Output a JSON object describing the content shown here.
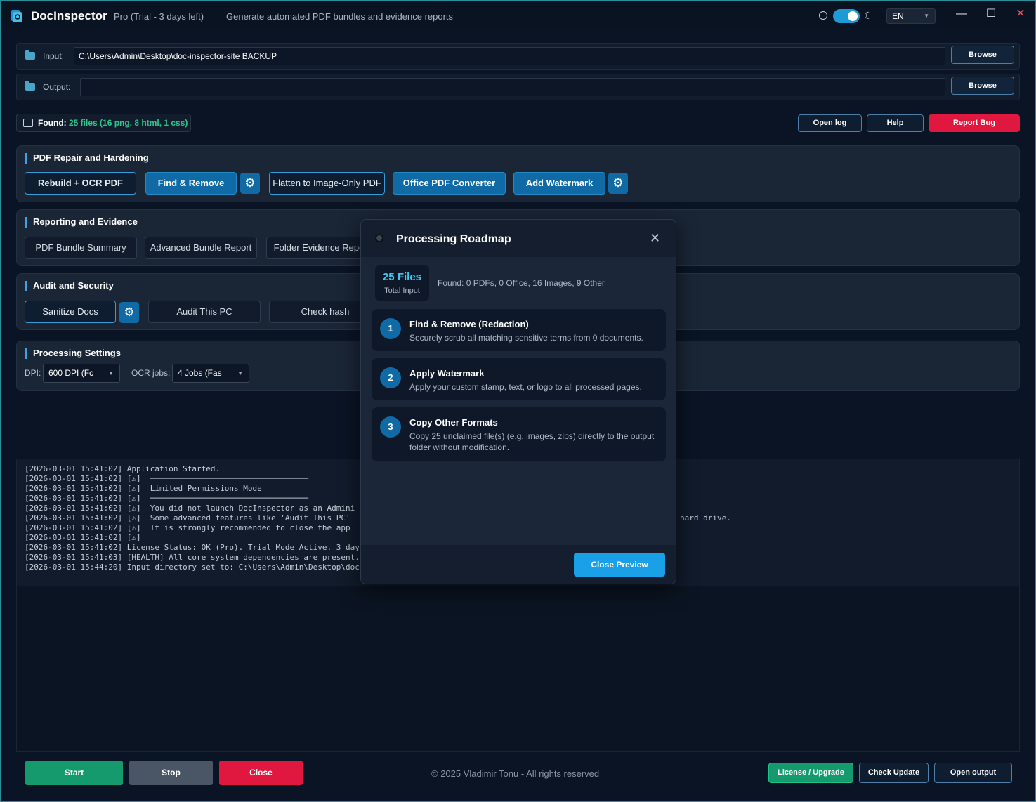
{
  "app": {
    "title": "DocInspector",
    "plan": "Pro (Trial - 3 days left)",
    "tagline": "Generate automated PDF bundles and evidence reports",
    "language": "EN"
  },
  "paths": {
    "input_label": "Input:",
    "input_value": "C:\\Users\\Admin\\Desktop\\doc-inspector-site BACKUP",
    "output_label": "Output:",
    "output_value": "",
    "browse_label": "Browse"
  },
  "found": {
    "label": "Found:",
    "value": "25 files (16 png, 8 html, 1 css)"
  },
  "top_buttons": {
    "open_log": "Open log",
    "help": "Help",
    "report_bug": "Report Bug"
  },
  "sections": {
    "repair": {
      "title": "PDF Repair and Hardening",
      "buttons": [
        "Rebuild + OCR PDF",
        "Find & Remove",
        "Flatten to Image-Only PDF",
        "Office PDF Converter",
        "Add Watermark"
      ]
    },
    "reporting": {
      "title": "Reporting and Evidence",
      "buttons": [
        "PDF Bundle Summary",
        "Advanced Bundle Report",
        "Folder Evidence Repo"
      ]
    },
    "audit": {
      "title": "Audit and Security",
      "buttons": [
        "Sanitize Docs",
        "Audit This PC",
        "Check hash"
      ]
    },
    "settings": {
      "title": "Processing Settings",
      "dpi_label": "DPI:",
      "dpi_value": "600 DPI  (Fc",
      "ocr_label": "OCR jobs:",
      "ocr_value": "4 Jobs  (Fas"
    }
  },
  "log": {
    "lines": [
      "[2026-03-01 15:41:02] Application Started.",
      "[2026-03-01 15:41:02] [⚠]  ──────────────────────────────────",
      "[2026-03-01 15:41:02] [⚠]  Limited Permissions Mode",
      "[2026-03-01 15:41:02] [⚠]  ──────────────────────────────────",
      "[2026-03-01 15:41:02] [⚠]  You did not launch DocInspector as an Admini",
      "[2026-03-01 15:41:02] [⚠]  Some advanced features like 'Audit This PC'",
      "[2026-03-01 15:41:02] [⚠]  It is strongly recommended to close the app",
      "[2026-03-01 15:41:02] [⚠]",
      "[2026-03-01 15:41:02] License Status: OK (Pro). Trial Mode Active. 3 days",
      "[2026-03-01 15:41:03] [HEALTH] All core system dependencies are present.",
      "[2026-03-01 15:44:20] Input directory set to: C:\\Users\\Admin\\Desktop\\doc-"
    ],
    "overflow_text": "hard drive."
  },
  "bottom": {
    "start": "Start",
    "stop": "Stop",
    "close": "Close",
    "footer": "© 2025 Vladimir Tonu - All rights reserved",
    "license": "License / Upgrade",
    "check_update": "Check Update",
    "open_output": "Open output"
  },
  "modal": {
    "title": "Processing Roadmap",
    "count": "25 Files",
    "count_sub": "Total Input",
    "found": "Found: 0 PDFs, 0 Office, 16 Images, 9 Other",
    "steps": [
      {
        "num": "1",
        "title": "Find & Remove (Redaction)",
        "desc": "Securely scrub all matching sensitive terms from 0 documents."
      },
      {
        "num": "2",
        "title": "Apply Watermark",
        "desc": "Apply your custom stamp, text, or logo to all processed pages."
      },
      {
        "num": "3",
        "title": "Copy Other Formats",
        "desc": "Copy 25 unclaimed file(s) (e.g. images, zips) directly to the output folder without modification."
      }
    ],
    "close_button": "Close Preview"
  },
  "colors": {
    "accent": "#1aa0e6",
    "success": "#149a6d",
    "danger": "#e0183f",
    "found_value": "#2fc58a"
  }
}
